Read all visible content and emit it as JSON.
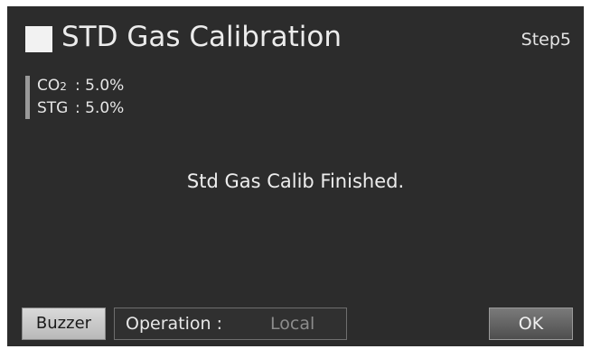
{
  "header": {
    "title": "STD Gas Calibration",
    "step": "Step5"
  },
  "gas_values": [
    {
      "name": "CO",
      "subscript": "2",
      "separator": ":",
      "value": "5.0%"
    },
    {
      "name": "STG",
      "subscript": "",
      "separator": ":",
      "value": "5.0%"
    }
  ],
  "message": "Std Gas Calib Finished.",
  "footer": {
    "buzzer_label": "Buzzer",
    "operation_label": "Operation :",
    "operation_value": "Local",
    "ok_label": "OK"
  },
  "colors": {
    "screen_background": "#2c2c2c",
    "text": "#ececec",
    "accent_bar": "#9a9a9a",
    "inactive_value": "#8c8c8c"
  }
}
